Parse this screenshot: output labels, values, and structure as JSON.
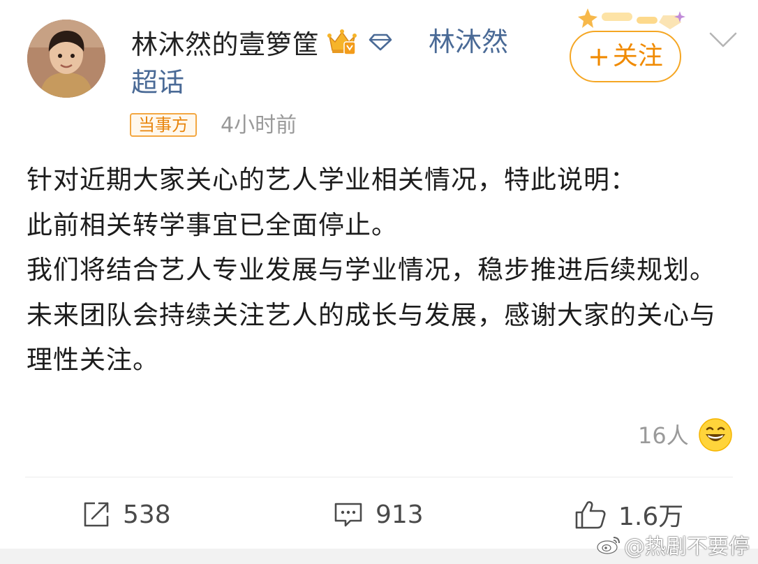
{
  "author": {
    "name": "林沐然的壹箩筐",
    "vip_icon": "crown-vip-badge-icon",
    "supertopic_icon": "diamond-icon",
    "supertopic_line1": "林沐然",
    "supertopic_line2": "超话"
  },
  "follow": {
    "plus": "+",
    "label": "关注"
  },
  "meta": {
    "badge": "当事方",
    "time": "4小时前"
  },
  "content": {
    "paragraphs": [
      "针对近期大家关心的艺人学业相关情况，特此说明：",
      "此前相关转学事宜已全面停止。",
      "我们将结合艺人专业发展与学业情况，稳步推进后续规划。",
      "未来团队会持续关注艺人的成长与发展，感谢大家的关心与理性关注。"
    ]
  },
  "reactions": {
    "count": "16人",
    "emoji": "grinning-face-icon"
  },
  "actions": {
    "repost": "538",
    "comment": "913",
    "like": "1.6万"
  },
  "watermark": {
    "text": "@热剧不要停"
  },
  "colors": {
    "accent_orange": "#f08a00",
    "link_blue": "#4a6a96",
    "meta_gray": "#999999",
    "text": "#1c1c1c"
  }
}
